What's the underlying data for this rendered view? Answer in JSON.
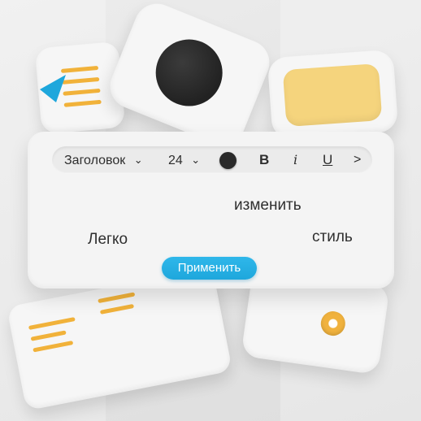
{
  "colors": {
    "accent": "#1ea7dc",
    "text_color_swatch": "#2a2a2a",
    "decor_yellow": "#f5d47d",
    "decor_orange": "#f0b23e"
  },
  "toolbar": {
    "heading_dropdown": "Заголовок",
    "font_size_dropdown": "24",
    "text_color_icon": "filled-circle",
    "bold_label": "B",
    "italic_label": "i",
    "underline_label": "U",
    "more_label": ">",
    "chevron_icon": "chevron-down-icon"
  },
  "content": {
    "word_1": "Легко",
    "word_2": "изменить",
    "word_3": "стиль"
  },
  "apply_button": {
    "label": "Применить"
  }
}
